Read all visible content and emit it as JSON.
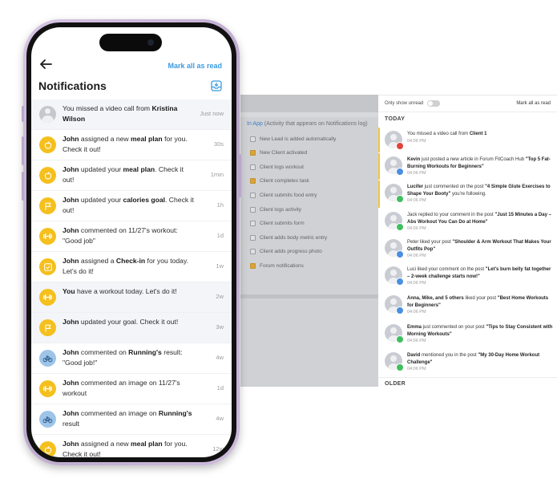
{
  "desktop_settings": {
    "in_app_prefix": "In App",
    "in_app_text": " (Activity that appears on Notifications log)",
    "options": [
      {
        "label": "New Lead is added automatically",
        "checked": false
      },
      {
        "label": "New Client activated",
        "checked": true
      },
      {
        "label": "Client logs workout",
        "checked": false
      },
      {
        "label": "Client completes task",
        "checked": true
      },
      {
        "label": "Client submits food entry",
        "checked": false
      },
      {
        "label": "Client logs activity",
        "checked": false
      },
      {
        "label": "Client submits form",
        "checked": false
      },
      {
        "label": "Client adds body metric entry",
        "checked": false
      },
      {
        "label": "Client adds progress photo",
        "checked": false
      },
      {
        "label": "Forum notifications",
        "checked": true
      }
    ]
  },
  "desktop_notifications": {
    "only_show_unread": "Only show unread",
    "mark_all": "Mark all as read",
    "section_today": "TODAY",
    "section_older": "OLDER",
    "items": [
      {
        "pre": "You missed a video call from ",
        "bold1": "Client 1",
        "mid": "",
        "bold2": "",
        "post": "",
        "time": "04:06 PM",
        "badge": "#e0443a",
        "unread": true
      },
      {
        "pre": "",
        "bold1": "Kevin",
        "mid": " just posted a new article in Forum FitCoach Hub ",
        "bold2": "\"Top 5 Fat-Burning Workouts for Beginners\"",
        "post": "",
        "time": "04:06 PM",
        "badge": "#4a8fe0",
        "unread": true
      },
      {
        "pre": "",
        "bold1": "Lucifer",
        "mid": " just commented on the post ",
        "bold2": "\"4 Simple Glute Exercises to Shape Your Booty\"",
        "post": " you're following.",
        "time": "04:06 PM",
        "badge": "#3fbf5f",
        "unread": true
      },
      {
        "pre": "Jack replied to your comment in the post ",
        "bold1": "\"Just 15 Minutes a Day – Abs Workout You Can Do at Home\"",
        "mid": "",
        "bold2": "",
        "post": "",
        "time": "04:06 PM",
        "badge": "#3fbf5f",
        "unread": false
      },
      {
        "pre": "Peter liked your post ",
        "bold1": "\"Shoulder & Arm Workout That Makes Your Outfits Pop\"",
        "mid": "",
        "bold2": "",
        "post": "",
        "time": "04:06 PM",
        "badge": "#4a8fe0",
        "unread": false
      },
      {
        "pre": "Luci liked your comment on the post ",
        "bold1": "\"Let's burn belly fat together – 2-week challenge starts now!\"",
        "mid": "",
        "bold2": "",
        "post": "",
        "time": "04:06 PM",
        "badge": "#4a8fe0",
        "unread": false
      },
      {
        "pre": "",
        "bold1": "Anna, Mike, and 5 others",
        "mid": " liked your post ",
        "bold2": "\"Best Home Workouts for Beginners\"",
        "post": "",
        "time": "04:06 PM",
        "badge": "#4a8fe0",
        "unread": false
      },
      {
        "pre": "",
        "bold1": "Emma",
        "mid": " just commented on your post ",
        "bold2": "\"Tips to Stay Consistent with Morning Workouts\"",
        "post": "",
        "time": "04:06 PM",
        "badge": "#3fbf5f",
        "unread": false
      },
      {
        "pre": "",
        "bold1": "David",
        "mid": " mentioned you in the post ",
        "bold2": "\"My 30-Day Home Workout Challenge\"",
        "post": "",
        "time": "04:06 PM",
        "badge": "#3fbf5f",
        "unread": false
      }
    ]
  },
  "mobile": {
    "mark_all": "Mark all as read",
    "title": "Notifications",
    "items": [
      {
        "icon": "avatar",
        "pre": "You missed a video call from ",
        "bold1": "Kristina Wilson",
        "mid": "",
        "bold2": "",
        "post": "",
        "time": "Just now"
      },
      {
        "icon": "apple",
        "pre": "",
        "bold1": "John",
        "mid": " assigned a new ",
        "bold2": "meal plan",
        "post": " for you. Check it out!",
        "time": "30s"
      },
      {
        "icon": "apple",
        "pre": "",
        "bold1": "John",
        "mid": " updated your ",
        "bold2": "meal plan",
        "post": ". Check it out!",
        "time": "1min"
      },
      {
        "icon": "flag",
        "pre": "",
        "bold1": "John",
        "mid": " updated your ",
        "bold2": "calories goal",
        "post": ". Check it out!",
        "time": "1h"
      },
      {
        "icon": "dumbbell",
        "pre": "",
        "bold1": "John",
        "mid": " commented on 11/27's workout: \"Good job\"",
        "bold2": "",
        "post": "",
        "time": "1d"
      },
      {
        "icon": "checkin",
        "pre": "",
        "bold1": "John",
        "mid": " assigned a ",
        "bold2": "Check-in",
        "post": " for you today. Let's do it!",
        "time": "1w"
      },
      {
        "icon": "dumbbell",
        "pre": "",
        "bold1": "You",
        "mid": " have a workout today. Let's do it!",
        "bold2": "",
        "post": "",
        "time": "2w"
      },
      {
        "icon": "flag",
        "pre": "",
        "bold1": "John",
        "mid": " updated your goal. Check it out!",
        "bold2": "",
        "post": "",
        "time": "3w"
      },
      {
        "icon": "bike",
        "pre": "",
        "bold1": "John",
        "mid": " commented on ",
        "bold2": "Running's",
        "post": " result: \"Good job!\"",
        "time": "4w"
      },
      {
        "icon": "dumbbell",
        "pre": "",
        "bold1": "John",
        "mid": " commented an image on 11/27's workout",
        "bold2": "",
        "post": "",
        "time": "1d"
      },
      {
        "icon": "bike",
        "pre": "",
        "bold1": "John",
        "mid": " commented an image on ",
        "bold2": "Running's",
        "post": " result",
        "time": "4w"
      },
      {
        "icon": "apple",
        "pre": "",
        "bold1": "John",
        "mid": " assigned a new ",
        "bold2": "meal plan",
        "post": " for you. Check it out!",
        "time": "12w"
      }
    ]
  }
}
